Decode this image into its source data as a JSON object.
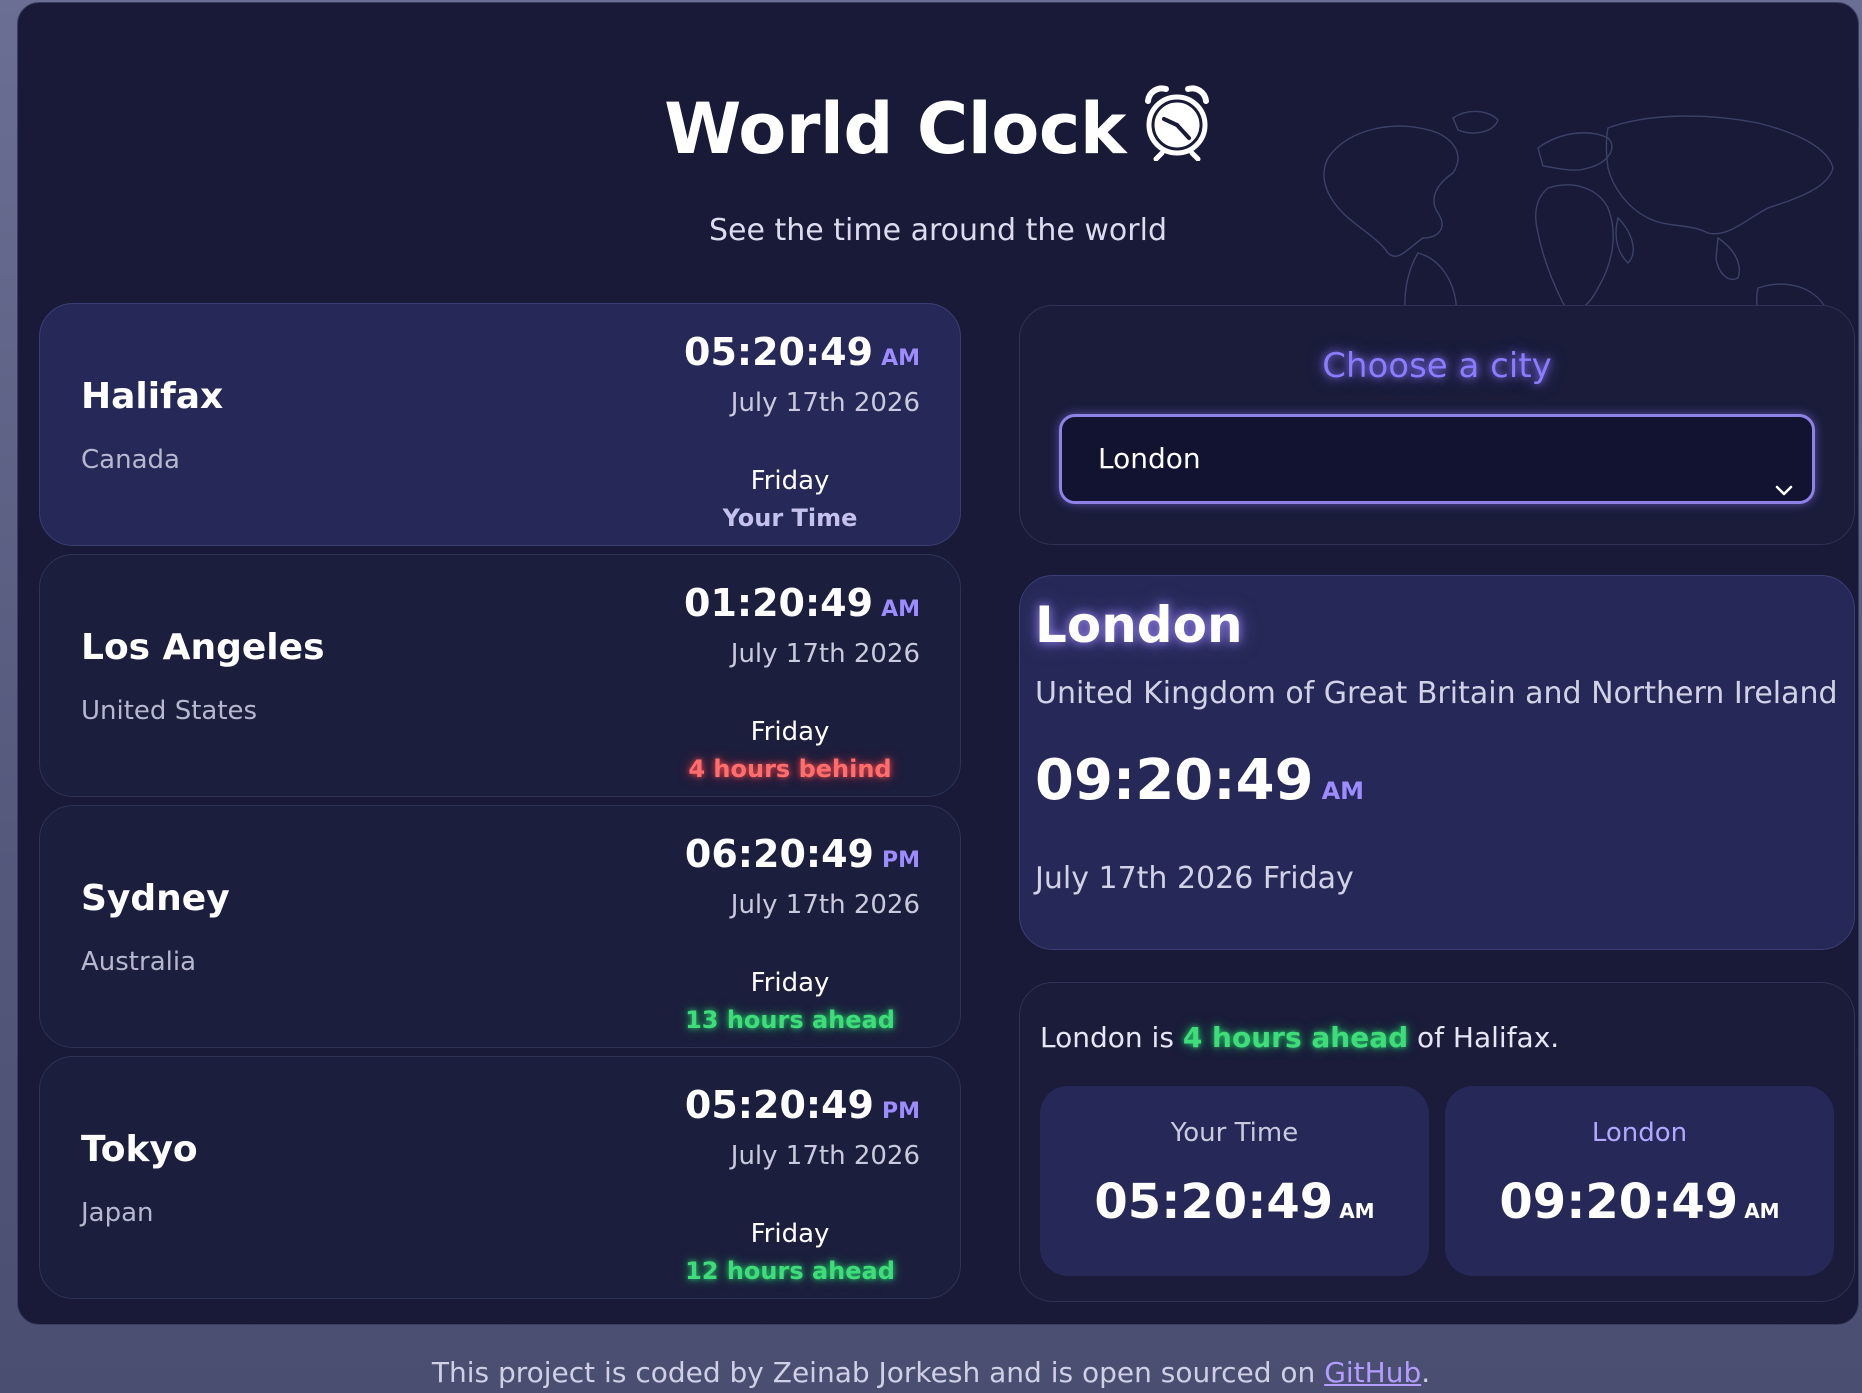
{
  "header": {
    "title": "World Clock",
    "icon": "alarm-clock-icon",
    "subtitle": "See the time around the world"
  },
  "cities": [
    {
      "name": "Halifax",
      "country": "Canada",
      "time": "05:20:49",
      "ampm": "AM",
      "date": "July 17th 2026",
      "day": "Friday",
      "status": "Your Time",
      "status_type": "your"
    },
    {
      "name": "Los Angeles",
      "country": "United States",
      "time": "01:20:49",
      "ampm": "AM",
      "date": "July 17th 2026",
      "day": "Friday",
      "status": "4 hours behind",
      "status_type": "behind"
    },
    {
      "name": "Sydney",
      "country": "Australia",
      "time": "06:20:49",
      "ampm": "PM",
      "date": "July 17th 2026",
      "day": "Friday",
      "status": "13 hours ahead",
      "status_type": "ahead"
    },
    {
      "name": "Tokyo",
      "country": "Japan",
      "time": "05:20:49",
      "ampm": "PM",
      "date": "July 17th 2026",
      "day": "Friday",
      "status": "12 hours ahead",
      "status_type": "ahead"
    }
  ],
  "chooser": {
    "label": "Choose a city",
    "selected": "London"
  },
  "selected_city": {
    "name": "London",
    "country": "United Kingdom of Great Britain and Northern Ireland",
    "time": "09:20:49",
    "ampm": "AM",
    "date": "July 17th 2026",
    "day": "Friday"
  },
  "comparison": {
    "prefix": "London is",
    "diff": "4 hours ahead",
    "suffix": "of Halifax.",
    "your_label": "Your Time",
    "your_time": "05:20:49",
    "your_ampm": "AM",
    "other_label": "London",
    "other_time": "09:20:49",
    "other_ampm": "AM"
  },
  "footer": {
    "text": "This project is coded by Zeinab Jorkesh and is open sourced on",
    "link": "GitHub",
    "end": "."
  },
  "colors": {
    "accent": "#8b7cff",
    "behind": "#ff6d6d",
    "ahead": "#3fdc7a",
    "panel": "#181a37"
  }
}
